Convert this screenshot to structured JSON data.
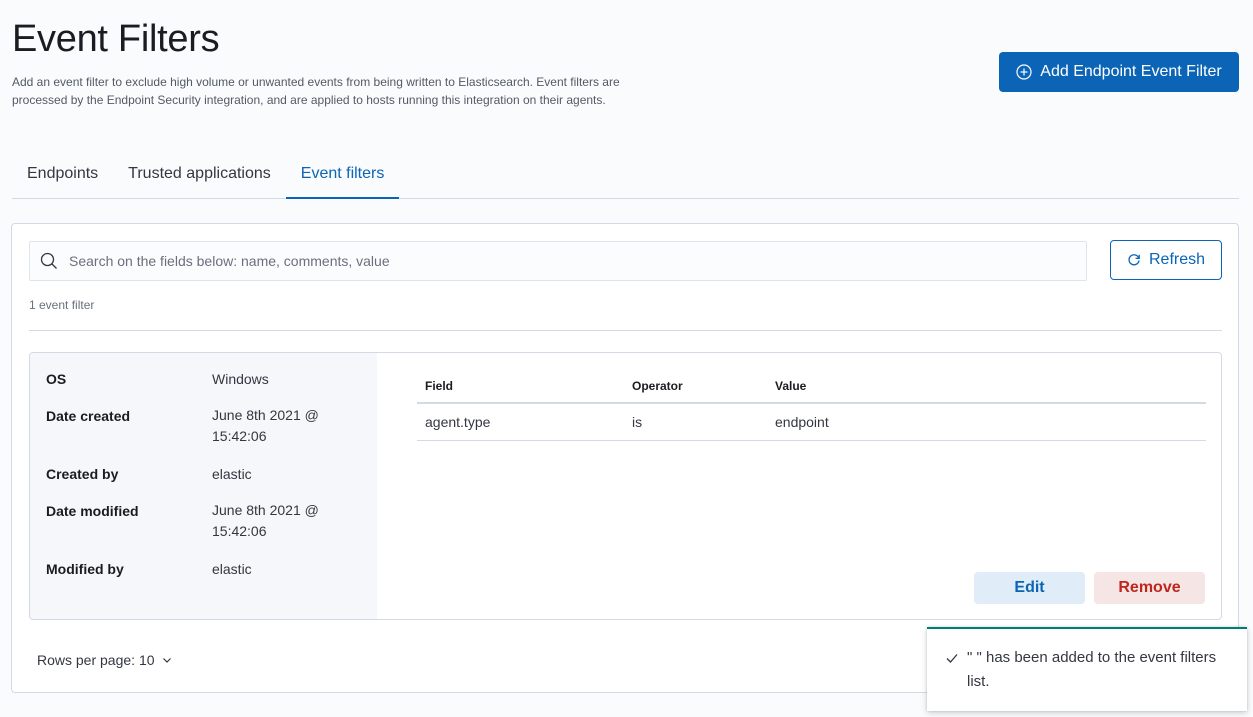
{
  "header": {
    "title": "Event Filters",
    "description": "Add an event filter to exclude high volume or unwanted events from being written to Elasticsearch. Event filters are processed by the Endpoint Security integration, and are applied to hosts running this integration on their agents.",
    "add_button_label": "Add Endpoint Event Filter",
    "add_button_icon": "plus-in-circle-icon"
  },
  "tabs": [
    {
      "label": "Endpoints",
      "active": false
    },
    {
      "label": "Trusted applications",
      "active": false
    },
    {
      "label": "Event filters",
      "active": true
    }
  ],
  "search": {
    "placeholder": "Search on the fields below: name, comments, value",
    "value": ""
  },
  "refresh_label": "Refresh",
  "count_label": "1 event filter",
  "card": {
    "details": [
      {
        "term": "OS",
        "value": "Windows"
      },
      {
        "term": "Date created",
        "value": "June 8th 2021 @ 15:42:06"
      },
      {
        "term": "Created by",
        "value": "elastic"
      },
      {
        "term": "Date modified",
        "value": "June 8th 2021 @ 15:42:06"
      },
      {
        "term": "Modified by",
        "value": "elastic"
      }
    ],
    "criteria": {
      "headers": [
        "Field",
        "Operator",
        "Value"
      ],
      "rows": [
        [
          "agent.type",
          "is",
          "endpoint"
        ]
      ]
    },
    "edit_label": "Edit",
    "remove_label": "Remove"
  },
  "pagination": {
    "rows_per_page_label": "Rows per page: 10"
  },
  "toast": {
    "text": "\" \" has been added to the event filters list."
  },
  "colors": {
    "primary": "#0b64b5",
    "danger": "#bd271e",
    "success_accent": "#017d73"
  }
}
